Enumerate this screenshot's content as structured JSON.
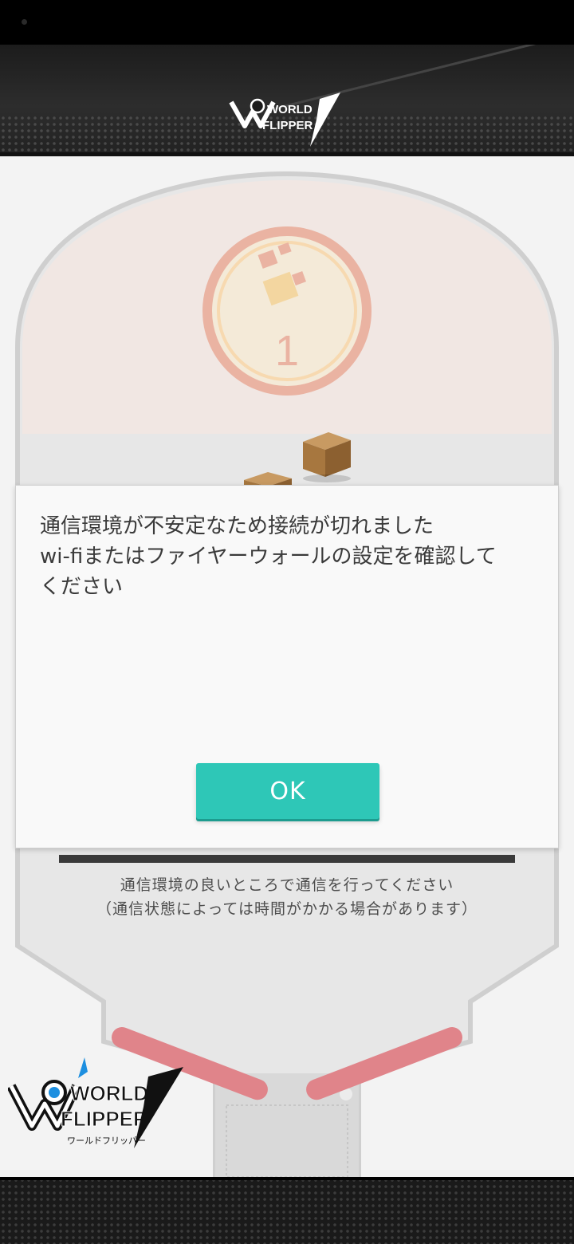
{
  "header": {
    "logo_text_line1": "WORLD",
    "logo_text_line2": "FLIPPER"
  },
  "board": {
    "badge_number": "1"
  },
  "loading": {
    "progress": 1.0,
    "message_line1": "通信環境の良いところで通信を行ってください",
    "message_line2": "（通信状態によっては時間がかかる場合があります）"
  },
  "dialog": {
    "message": "通信環境が不安定なため接続が切れました\nwi-fiまたはファイヤーウォールの設定を確認して\nください",
    "ok_label": "OK"
  },
  "footer": {
    "logo_text_line1": "WORLD",
    "logo_text_line2": "FLIPPER",
    "logo_subtitle": "ワールドフリッパー"
  },
  "colors": {
    "accent": "#2ec7b7",
    "flipper": "#e0848a",
    "badge": "#eab3a2"
  }
}
